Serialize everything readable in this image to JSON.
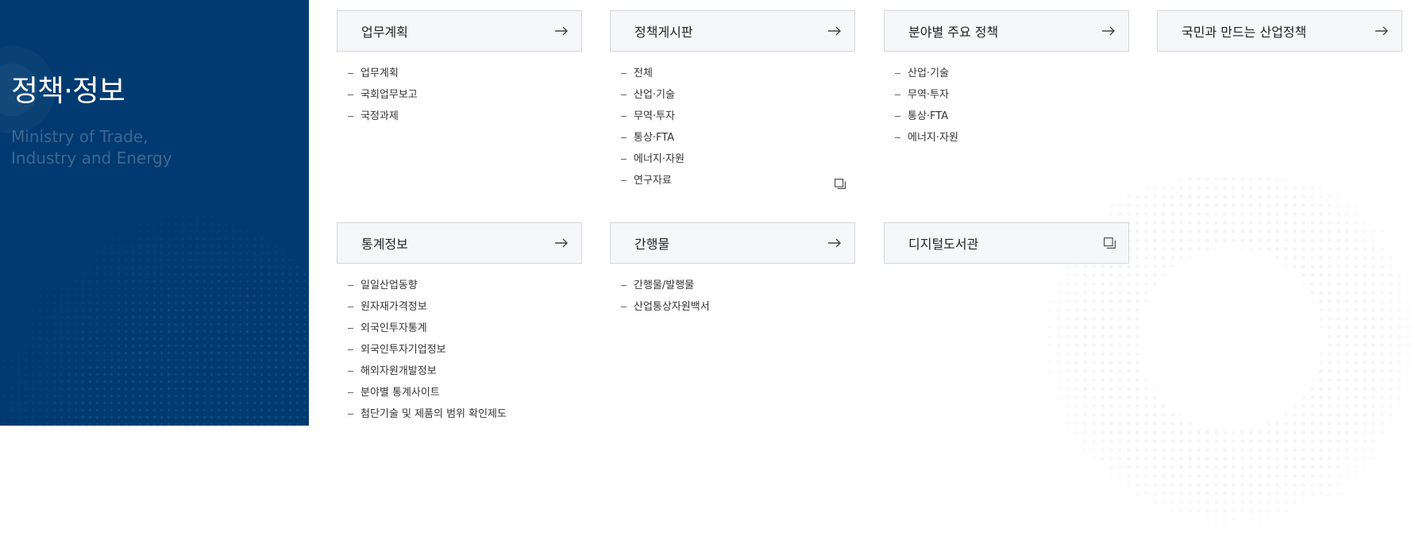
{
  "sidebar": {
    "title": "정책·정보",
    "subtitle_line1": "Ministry of Trade,",
    "subtitle_line2": "Industry and Energy",
    "bg_color": "#003a70"
  },
  "sections": [
    {
      "title": "업무계획",
      "icon": "arrow-right-icon",
      "items": [
        "업무계획",
        "국회업무보고",
        "국정과제"
      ]
    },
    {
      "title": "정책게시판",
      "icon": "arrow-right-icon",
      "items": [
        "전체",
        "산업·기술",
        "무역·투자",
        "통상·FTA",
        "에너지·자원",
        "연구자료"
      ],
      "external_item": "연구자료"
    },
    {
      "title": "분야별 주요 정책",
      "icon": "arrow-right-icon",
      "items": [
        "산업·기술",
        "무역·투자",
        "통상·FTA",
        "에너지·자원"
      ]
    },
    {
      "title": "국민과 만드는 산업정책",
      "icon": "arrow-right-icon",
      "items": []
    },
    {
      "title": "통계정보",
      "icon": "arrow-right-icon",
      "items": [
        "일일산업동향",
        "원자재가격정보",
        "외국인투자통계",
        "외국인투자기업정보",
        "해외자원개발정보",
        "분야별 통계사이트",
        "첨단기술 및 제품의 범위 확인제도"
      ]
    },
    {
      "title": "간행물",
      "icon": "arrow-right-icon",
      "items": [
        "간행물/발행물",
        "산업통상자원백서"
      ]
    },
    {
      "title": "디지털도서관",
      "icon": "new-window-icon",
      "items": []
    }
  ]
}
